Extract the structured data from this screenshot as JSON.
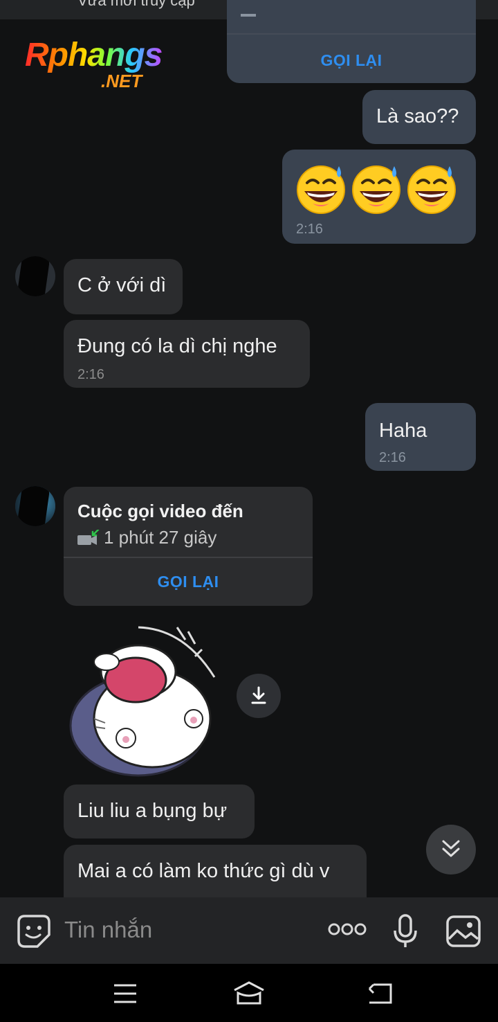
{
  "status": {
    "text": "Vừa mới truy cập"
  },
  "watermark": {
    "brand": "Rphangs",
    "tld": ".NET"
  },
  "messages": {
    "top_call": {
      "action": "GỌI LẠI"
    },
    "m1": {
      "text": "Là sao??"
    },
    "m2": {
      "emoji": "😅😅😅",
      "time": "2:16"
    },
    "m3": {
      "text": "C ở với dì"
    },
    "m4": {
      "text": "Đung có la dì chị nghe",
      "time": "2:16"
    },
    "m5": {
      "text": "Haha",
      "time": "2:16"
    },
    "call": {
      "title": "Cuộc gọi video đến",
      "duration": "1 phút 27 giây",
      "action": "GỌI LẠI"
    },
    "m7": {
      "text": "Liu liu a bụng bự"
    },
    "m8": {
      "text": "Mai a có làm ko thức gì dù v"
    }
  },
  "composer": {
    "placeholder": "Tin nhắn",
    "more_label": "ooo"
  },
  "icons": [
    "sticker-icon",
    "more-icon",
    "mic-icon",
    "image-icon",
    "download-icon",
    "scroll-down-icon",
    "menu-icon",
    "home-icon",
    "back-icon"
  ],
  "colors": {
    "outgoing_bubble": "#3a4350",
    "incoming_bubble": "#2b2c2e",
    "accent": "#2e8ef0",
    "background": "#111213"
  }
}
